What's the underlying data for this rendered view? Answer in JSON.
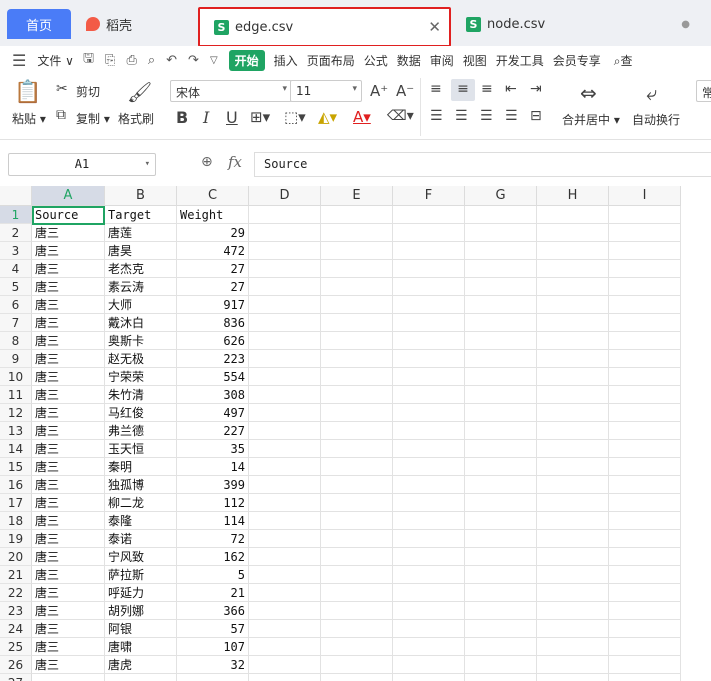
{
  "tabs": {
    "home": "首页",
    "daoke": "稻壳",
    "edge": "edge.csv",
    "node": "node.csv"
  },
  "menu": {
    "file": "文件",
    "items": [
      "开始",
      "插入",
      "页面布局",
      "公式",
      "数据",
      "审阅",
      "视图",
      "开发工具",
      "会员专享"
    ],
    "search": "查"
  },
  "ribbon": {
    "paste": "粘贴",
    "cut": "剪切",
    "copy": "复制",
    "format_painter": "格式刷",
    "font": "宋体",
    "font_size": "11",
    "merge": "合并居中",
    "wrap": "自动换行",
    "right_clip": "常"
  },
  "namebox": "A1",
  "formula_value": "Source",
  "columns": [
    "A",
    "B",
    "C",
    "D",
    "E",
    "F",
    "G",
    "H",
    "I"
  ],
  "headers": [
    "Source",
    "Target",
    "Weight"
  ],
  "rows": [
    [
      "唐三",
      "唐莲",
      "29"
    ],
    [
      "唐三",
      "唐昊",
      "472"
    ],
    [
      "唐三",
      "老杰克",
      "27"
    ],
    [
      "唐三",
      "素云涛",
      "27"
    ],
    [
      "唐三",
      "大师",
      "917"
    ],
    [
      "唐三",
      "戴沐白",
      "836"
    ],
    [
      "唐三",
      "奥斯卡",
      "626"
    ],
    [
      "唐三",
      "赵无极",
      "223"
    ],
    [
      "唐三",
      "宁荣荣",
      "554"
    ],
    [
      "唐三",
      "朱竹清",
      "308"
    ],
    [
      "唐三",
      "马红俊",
      "497"
    ],
    [
      "唐三",
      "弗兰德",
      "227"
    ],
    [
      "唐三",
      "玉天恒",
      "35"
    ],
    [
      "唐三",
      "秦明",
      "14"
    ],
    [
      "唐三",
      "独孤博",
      "399"
    ],
    [
      "唐三",
      "柳二龙",
      "112"
    ],
    [
      "唐三",
      "泰隆",
      "114"
    ],
    [
      "唐三",
      "泰诺",
      "72"
    ],
    [
      "唐三",
      "宁风致",
      "162"
    ],
    [
      "唐三",
      "萨拉斯",
      "5"
    ],
    [
      "唐三",
      "呼延力",
      "21"
    ],
    [
      "唐三",
      "胡列娜",
      "366"
    ],
    [
      "唐三",
      "阿银",
      "57"
    ],
    [
      "唐三",
      "唐啸",
      "107"
    ],
    [
      "唐三",
      "唐虎",
      "32"
    ]
  ],
  "colors": {
    "accent": "#1fa463",
    "tab_blue": "#4a7cf7",
    "highlight": "#e02020"
  }
}
